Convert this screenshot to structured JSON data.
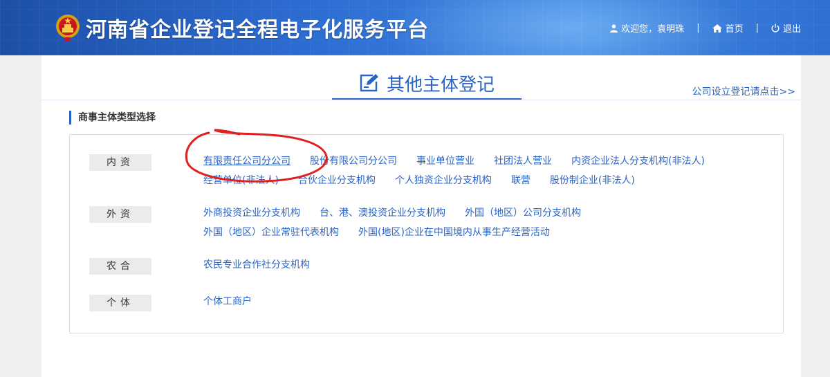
{
  "header": {
    "title": "河南省企业登记全程电子化服务平台",
    "welcome": "欢迎您，袁明珠",
    "separator": "|",
    "home_label": "首页",
    "logout_label": "退出",
    "icons": {
      "emblem": "national-emblem-icon",
      "user": "user-icon",
      "home": "home-icon",
      "logout": "power-icon"
    }
  },
  "main": {
    "page_title": "其他主体登记",
    "title_icon": "edit-icon",
    "company_link": "公司设立登记请点击>>",
    "section_title": "商事主体类型选择"
  },
  "categories": [
    {
      "label": "内资",
      "lines": [
        [
          "有限责任公司分公司",
          "股份有限公司分公司",
          "事业单位营业",
          "社团法人营业",
          "内资企业法人分支机构(非法人)"
        ],
        [
          "经营单位(非法人)",
          "合伙企业分支机构",
          "个人独资企业分支机构",
          "联营",
          "股份制企业(非法人)"
        ]
      ]
    },
    {
      "label": "外资",
      "lines": [
        [
          "外商投资企业分支机构",
          "台、港、澳投资企业分支机构",
          "外国（地区）公司分支机构"
        ],
        [
          "外国（地区）企业常驻代表机构",
          "外国(地区)企业在中国境内从事生产经营活动"
        ]
      ]
    },
    {
      "label": "农合",
      "lines": [
        [
          "农民专业合作社分支机构"
        ]
      ]
    },
    {
      "label": "个体",
      "lines": [
        [
          "个体工商户"
        ]
      ]
    }
  ],
  "colors": {
    "link": "#2a64c7",
    "header": "#2c6bd0",
    "annotation": "#e02020"
  }
}
